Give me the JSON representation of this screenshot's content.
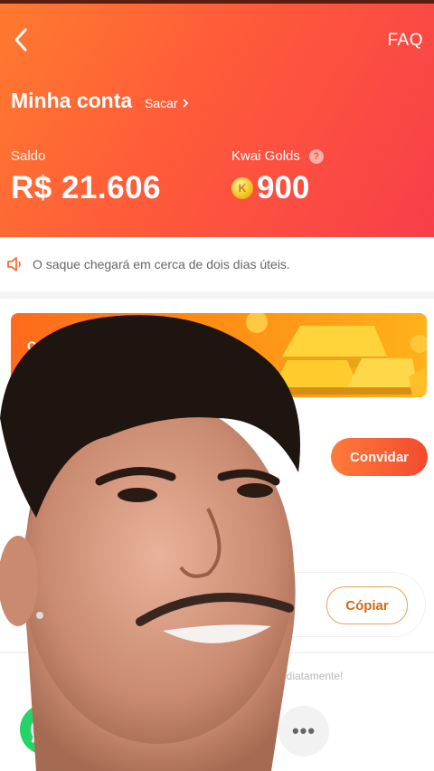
{
  "header": {
    "faq_label": "FAQ",
    "title": "Minha conta",
    "withdraw_label": "Sacar"
  },
  "balance": {
    "label": "Saldo",
    "value": "R$ 21.606"
  },
  "golds": {
    "label": "Kwai Golds",
    "value": "900"
  },
  "notice": {
    "text": "O saque chegará em cerca de dois dias úteis."
  },
  "banner": {
    "text": "Co"
  },
  "invite": {
    "button_label": "Convidar"
  },
  "code": {
    "copy_label": "Cópiar"
  },
  "share": {
    "hint": "mediatamente!",
    "more_label": "•••"
  },
  "colors": {
    "header_start": "#ff7a2e",
    "header_end": "#f83e4a",
    "accent": "#f24c2e",
    "whatsapp": "#25d366"
  },
  "icons": {
    "back": "chevron-left-icon",
    "help": "question-circle-icon",
    "coin": "kwai-coin-icon",
    "speaker": "speaker-icon",
    "whatsapp": "whatsapp-icon",
    "more": "more-dots-icon"
  }
}
